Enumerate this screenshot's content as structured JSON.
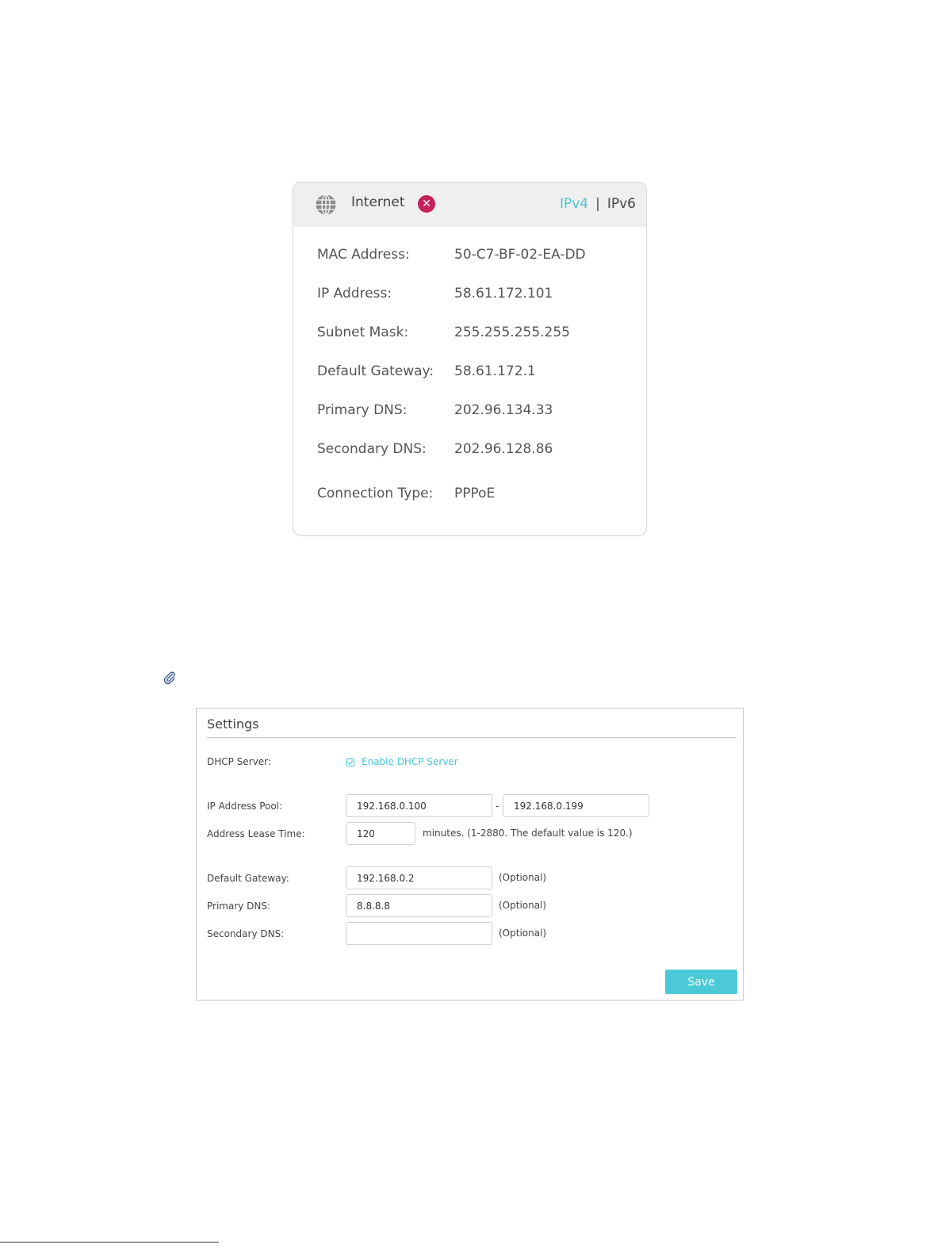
{
  "internet_card": {
    "title": "Internet",
    "status_icon": "error-x-icon",
    "tabs": {
      "ipv4": "IPv4",
      "separator": "|",
      "ipv6": "IPv6"
    },
    "accent_color": "#4cc3d5",
    "error_color": "#c7215d",
    "rows": [
      {
        "label": "MAC Address:",
        "value": "50-C7-BF-02-EA-DD"
      },
      {
        "label": "IP Address:",
        "value": "58.61.172.101"
      },
      {
        "label": "Subnet Mask:",
        "value": "255.255.255.255"
      },
      {
        "label": "Default Gateway:",
        "value": "58.61.172.1"
      },
      {
        "label": "Primary DNS:",
        "value": "202.96.134.33"
      },
      {
        "label": "Secondary DNS:",
        "value": "202.96.128.86"
      },
      {
        "label": "Connection Type:",
        "value": "PPPoE"
      }
    ]
  },
  "settings": {
    "title": "Settings",
    "dhcp_server_label": "DHCP Server:",
    "enable_dhcp_label": "Enable DHCP Server",
    "enable_dhcp_checked": true,
    "ip_pool_label": "IP Address Pool:",
    "ip_pool_start": "192.168.0.100",
    "ip_pool_dash": "-",
    "ip_pool_end": "192.168.0.199",
    "lease_label": "Address Lease Time:",
    "lease_value": "120",
    "lease_hint": "minutes. (1-2880. The default value is 120.)",
    "gateway_label": "Default Gateway:",
    "gateway_value": "192.168.0.2",
    "primary_dns_label": "Primary DNS:",
    "primary_dns_value": "8.8.8.8",
    "secondary_dns_label": "Secondary DNS:",
    "secondary_dns_value": "",
    "optional_hint": "(Optional)",
    "save_label": "Save",
    "save_color": "#4cc9d6"
  }
}
